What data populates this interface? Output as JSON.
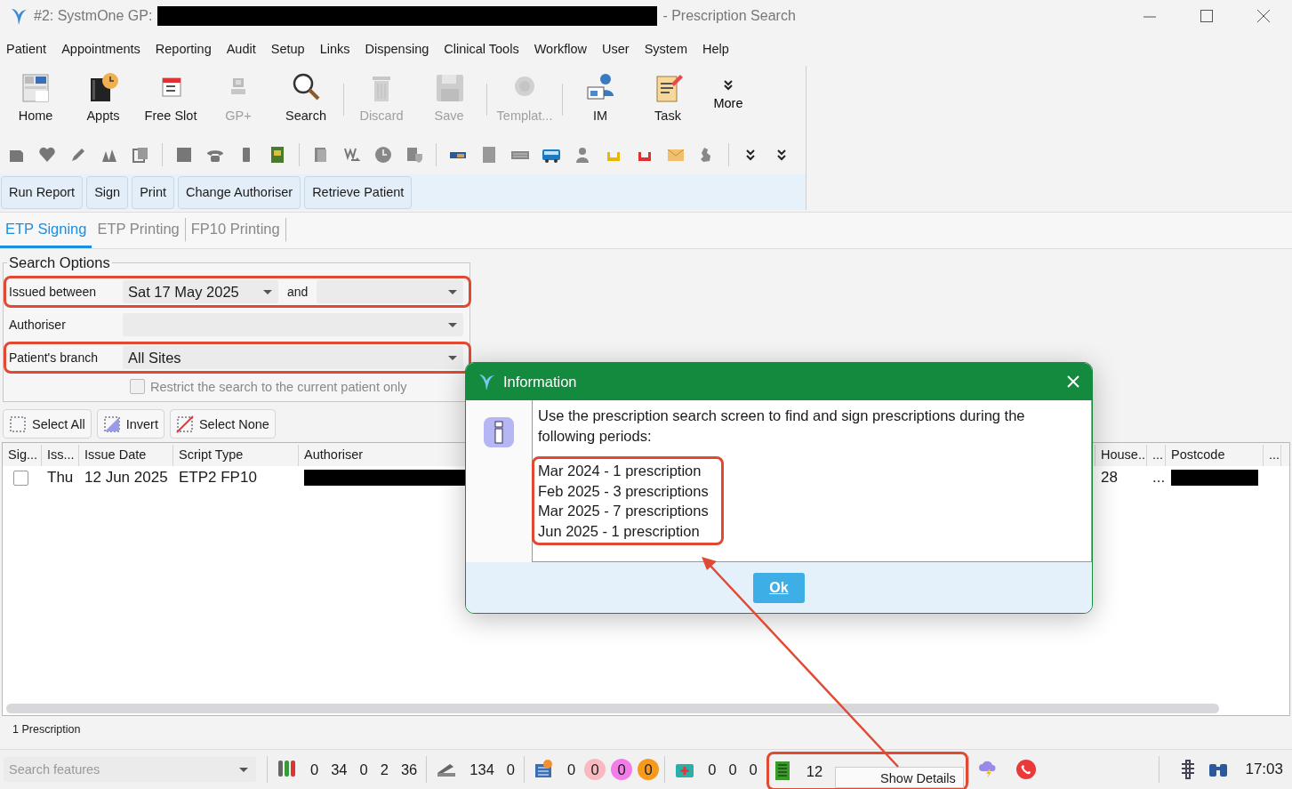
{
  "window": {
    "title": "#2: SystmOne GP:",
    "title_redacted": true,
    "title_suffix": "- Prescription Search"
  },
  "menu": [
    "Patient",
    "Appointments",
    "Reporting",
    "Audit",
    "Setup",
    "Links",
    "Dispensing",
    "Clinical Tools",
    "Workflow",
    "User",
    "System",
    "Help"
  ],
  "toolbar": {
    "groups": [
      [
        {
          "kind": "home",
          "label": "Home",
          "disabled": false
        },
        {
          "kind": "appts",
          "label": "Appts",
          "disabled": false
        },
        {
          "kind": "calendar",
          "label": "Free Slot",
          "disabled": false
        },
        {
          "kind": "gp",
          "label": "GP+",
          "disabled": true
        },
        {
          "kind": "search",
          "label": "Search",
          "disabled": false
        }
      ],
      [
        {
          "kind": "trash",
          "label": "Discard",
          "disabled": true
        },
        {
          "kind": "save",
          "label": "Save",
          "disabled": true
        }
      ],
      [
        {
          "kind": "template",
          "label": "Templat...",
          "disabled": true
        }
      ],
      [
        {
          "kind": "im",
          "label": "IM",
          "disabled": false
        },
        {
          "kind": "task",
          "label": "Task",
          "disabled": false
        }
      ]
    ],
    "more": "More"
  },
  "actions": [
    "Run Report",
    "Sign",
    "Print",
    "Change Authoriser",
    "Retrieve Patient"
  ],
  "tabs": [
    {
      "label": "ETP Signing",
      "selected": true
    },
    {
      "label": "ETP Printing",
      "selected": false
    },
    {
      "label": "FP10 Printing",
      "selected": false
    }
  ],
  "search_options": {
    "legend": "Search Options",
    "rows": [
      {
        "label": "Issued between",
        "value": "Sat 17 May 2025",
        "second_label": "and",
        "highlighted": true
      },
      {
        "label": "Authoriser",
        "highlighted": false
      },
      {
        "label": "Patient's branch",
        "value": "All Sites",
        "highlighted": true
      }
    ],
    "restrict": {
      "label": "Restrict the search to the current patient only",
      "checked": false,
      "disabled": true
    }
  },
  "selection_buttons": [
    {
      "kind": "all",
      "label": "Select All"
    },
    {
      "kind": "invert",
      "label": "Invert"
    },
    {
      "kind": "none",
      "label": "Select None"
    }
  ],
  "table": {
    "columns": [
      "Sig...",
      "Iss...",
      "Issue Date",
      "Script Type",
      "Authoriser",
      "House...",
      "...",
      "Postcode",
      "..."
    ],
    "rows": [
      {
        "cells": [
          {
            "kind": "checkbox",
            "checked": false
          },
          {
            "text": "Thu"
          },
          {
            "text": "12 Jun 2025"
          },
          {
            "text": "ETP2 FP10"
          },
          {
            "kind": "redacted"
          },
          {
            "text": "28"
          },
          {
            "text": "..."
          },
          {
            "kind": "redacted"
          }
        ]
      }
    ]
  },
  "footer": "1 Prescription",
  "dialog": {
    "title": "Information",
    "message": "Use the prescription search screen to find and sign prescriptions during the following periods:",
    "periods": [
      "Mar 2024 - 1 prescription",
      "Feb 2025 - 3 prescriptions",
      "Mar 2025 - 7 prescriptions",
      "Jun 2025 - 1 prescription"
    ],
    "periods_highlighted": true,
    "button": "Ok"
  },
  "status_bar": {
    "search_placeholder": "Search features",
    "groups": [
      {
        "kind": "tubes",
        "counts": [
          {
            "text": "0"
          },
          {
            "text": "34"
          },
          {
            "text": "0"
          },
          {
            "text": "2"
          },
          {
            "text": "36"
          }
        ]
      },
      {
        "kind": "scanner",
        "counts": [
          {
            "text": "134"
          },
          {
            "text": "0"
          }
        ]
      },
      {
        "kind": "calendar",
        "counts": [
          {
            "text": "0"
          },
          {
            "text": "0",
            "color": "#f9b9c0"
          },
          {
            "text": "0",
            "color": "#f37ce8"
          },
          {
            "text": "0",
            "color": "#f7991c"
          }
        ]
      },
      {
        "kind": "medkit",
        "counts": [
          {
            "text": "0"
          },
          {
            "text": "0"
          },
          {
            "text": "0"
          }
        ]
      },
      {
        "kind": "ledger",
        "counts": [
          {
            "text": "12"
          }
        ],
        "tooltip": "Show Details",
        "highlighted": true
      }
    ],
    "time": "17:03"
  }
}
